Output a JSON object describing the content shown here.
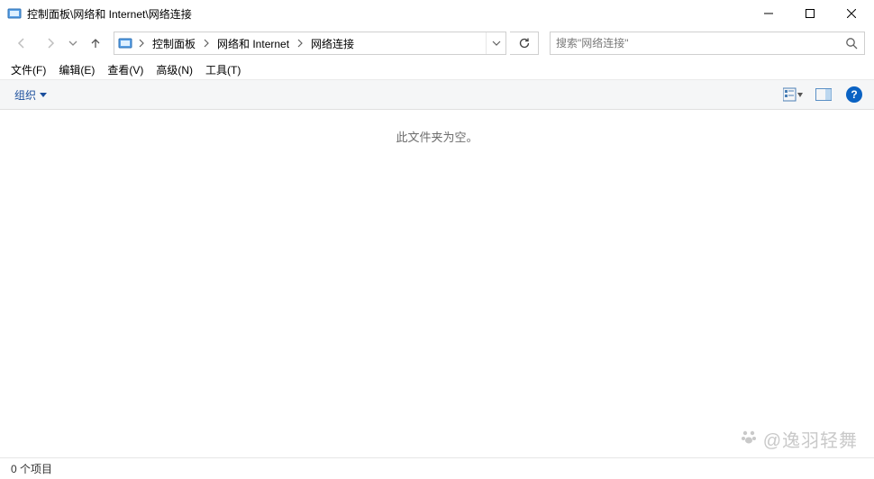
{
  "window": {
    "title": "控制面板\\网络和 Internet\\网络连接"
  },
  "breadcrumb": {
    "items": [
      "控制面板",
      "网络和 Internet",
      "网络连接"
    ]
  },
  "search": {
    "placeholder": "搜索\"网络连接\""
  },
  "menubar": {
    "items": [
      "文件(F)",
      "编辑(E)",
      "查看(V)",
      "高级(N)",
      "工具(T)"
    ]
  },
  "commandbar": {
    "organize": "组织"
  },
  "content": {
    "empty_message": "此文件夹为空。"
  },
  "statusbar": {
    "text": "0 个项目"
  },
  "watermark": {
    "text": "@逸羽轻舞"
  },
  "icons": {
    "help": "?"
  }
}
